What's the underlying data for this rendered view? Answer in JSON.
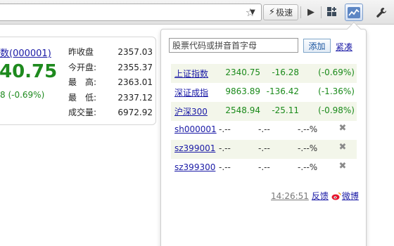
{
  "toolbar": {
    "speed_label": "极速",
    "icons": [
      "star-icon",
      "chevron-down-icon",
      "lightning-icon",
      "play-icon",
      "apps-icon",
      "stock-chart-icon",
      "wrench-icon"
    ]
  },
  "card": {
    "index_name": "数(000001)",
    "price": "40.75",
    "change": "8 (-0.69%)",
    "stats": [
      {
        "label": "昨收盘",
        "value": "2357.03"
      },
      {
        "label": "今开盘:",
        "value": "2355.37"
      },
      {
        "label": "最　高:",
        "value": "2363.01"
      },
      {
        "label": "最　低:",
        "value": "2337.12"
      },
      {
        "label": "成交量:",
        "value": "6972.92"
      }
    ]
  },
  "popup": {
    "search_placeholder": "股票代码或拼音首字母",
    "add_label": "添加",
    "compact_label": "紧凑",
    "rows": [
      {
        "name": "上证指数",
        "price": "2340.75",
        "change": "-16.28",
        "pct": "(-0.69%)",
        "deletable": false
      },
      {
        "name": "深证成指",
        "price": "9863.89",
        "change": "-136.42",
        "pct": "(-1.36%)",
        "deletable": false
      },
      {
        "name": "沪深300",
        "price": "2548.94",
        "change": "-25.11",
        "pct": "(-0.98%)",
        "deletable": false
      },
      {
        "name": "sh000001",
        "price": "-.--",
        "change": "-.--",
        "pct": "-.--%",
        "deletable": true
      },
      {
        "name": "sz399001",
        "price": "-.--",
        "change": "-.--",
        "pct": "-.--%",
        "deletable": true
      },
      {
        "name": "sz399300",
        "price": "-.--",
        "change": "-.--",
        "pct": "-.--%",
        "deletable": true
      }
    ],
    "footer": {
      "time": "14:26:51",
      "feedback": "反馈",
      "weibo": "微博"
    }
  },
  "colors": {
    "price_down": "#1e8a1e",
    "link": "#1a1aa6",
    "alt_row": "#f3f6ea"
  }
}
